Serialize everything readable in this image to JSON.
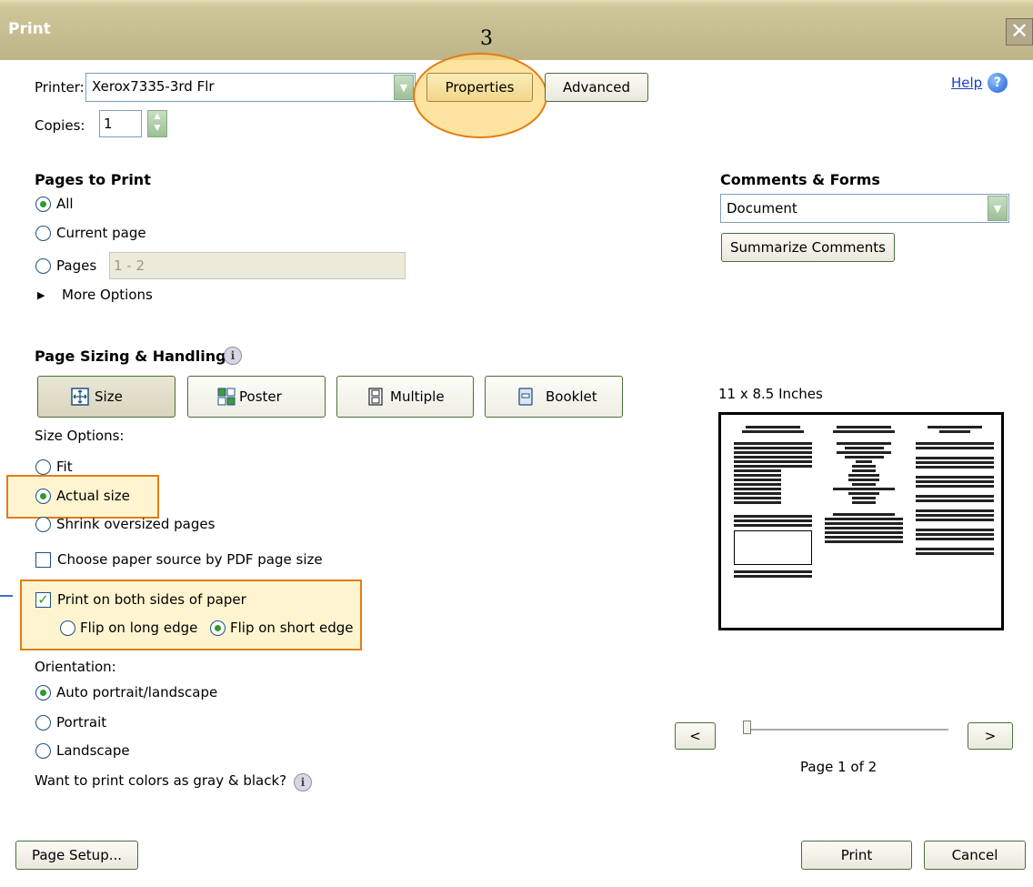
{
  "window": {
    "title": "Print",
    "close": "✕"
  },
  "annotation": {
    "step_number": "3"
  },
  "header": {
    "printer_label": "Printer:",
    "printer_value": "Xerox7335-3rd Flr",
    "properties_label": "Properties",
    "advanced_label": "Advanced",
    "help_label": "Help",
    "copies_label": "Copies:",
    "copies_value": "1"
  },
  "pages_to_print": {
    "heading": "Pages to Print",
    "all": "All",
    "current": "Current page",
    "pages": "Pages",
    "pages_placeholder": "1 - 2",
    "more_options": "More Options",
    "selected": "All"
  },
  "comments": {
    "heading": "Comments & Forms",
    "value": "Document",
    "summarize_label": "Summarize Comments"
  },
  "sizing": {
    "heading": "Page Sizing & Handling",
    "tabs": [
      {
        "label": "Size",
        "icon": "size-icon"
      },
      {
        "label": "Poster",
        "icon": "poster-icon"
      },
      {
        "label": "Multiple",
        "icon": "multiple-icon"
      },
      {
        "label": "Booklet",
        "icon": "booklet-icon"
      }
    ],
    "selected_tab": "Size",
    "size_options_label": "Size Options:",
    "fit": "Fit",
    "actual": "Actual size",
    "shrink": "Shrink oversized pages",
    "choose_source": "Choose paper source by PDF page size",
    "both_sides": "Print on both sides of paper",
    "flip_long": "Flip on long edge",
    "flip_short": "Flip on short edge"
  },
  "orientation": {
    "label": "Orientation:",
    "auto": "Auto portrait/landscape",
    "portrait": "Portrait",
    "landscape": "Landscape",
    "gray_question": "Want to print colors as gray & black?"
  },
  "preview": {
    "size_label": "11 x 8.5 Inches",
    "prev": "<",
    "next": ">",
    "page_indicator": "Page 1 of 2",
    "current_page": 1,
    "total_pages": 2
  },
  "footer": {
    "page_setup": "Page Setup...",
    "print": "Print",
    "cancel": "Cancel"
  },
  "colors": {
    "highlight_orange": "#e47c12",
    "radio_green": "#2d9a2d"
  }
}
